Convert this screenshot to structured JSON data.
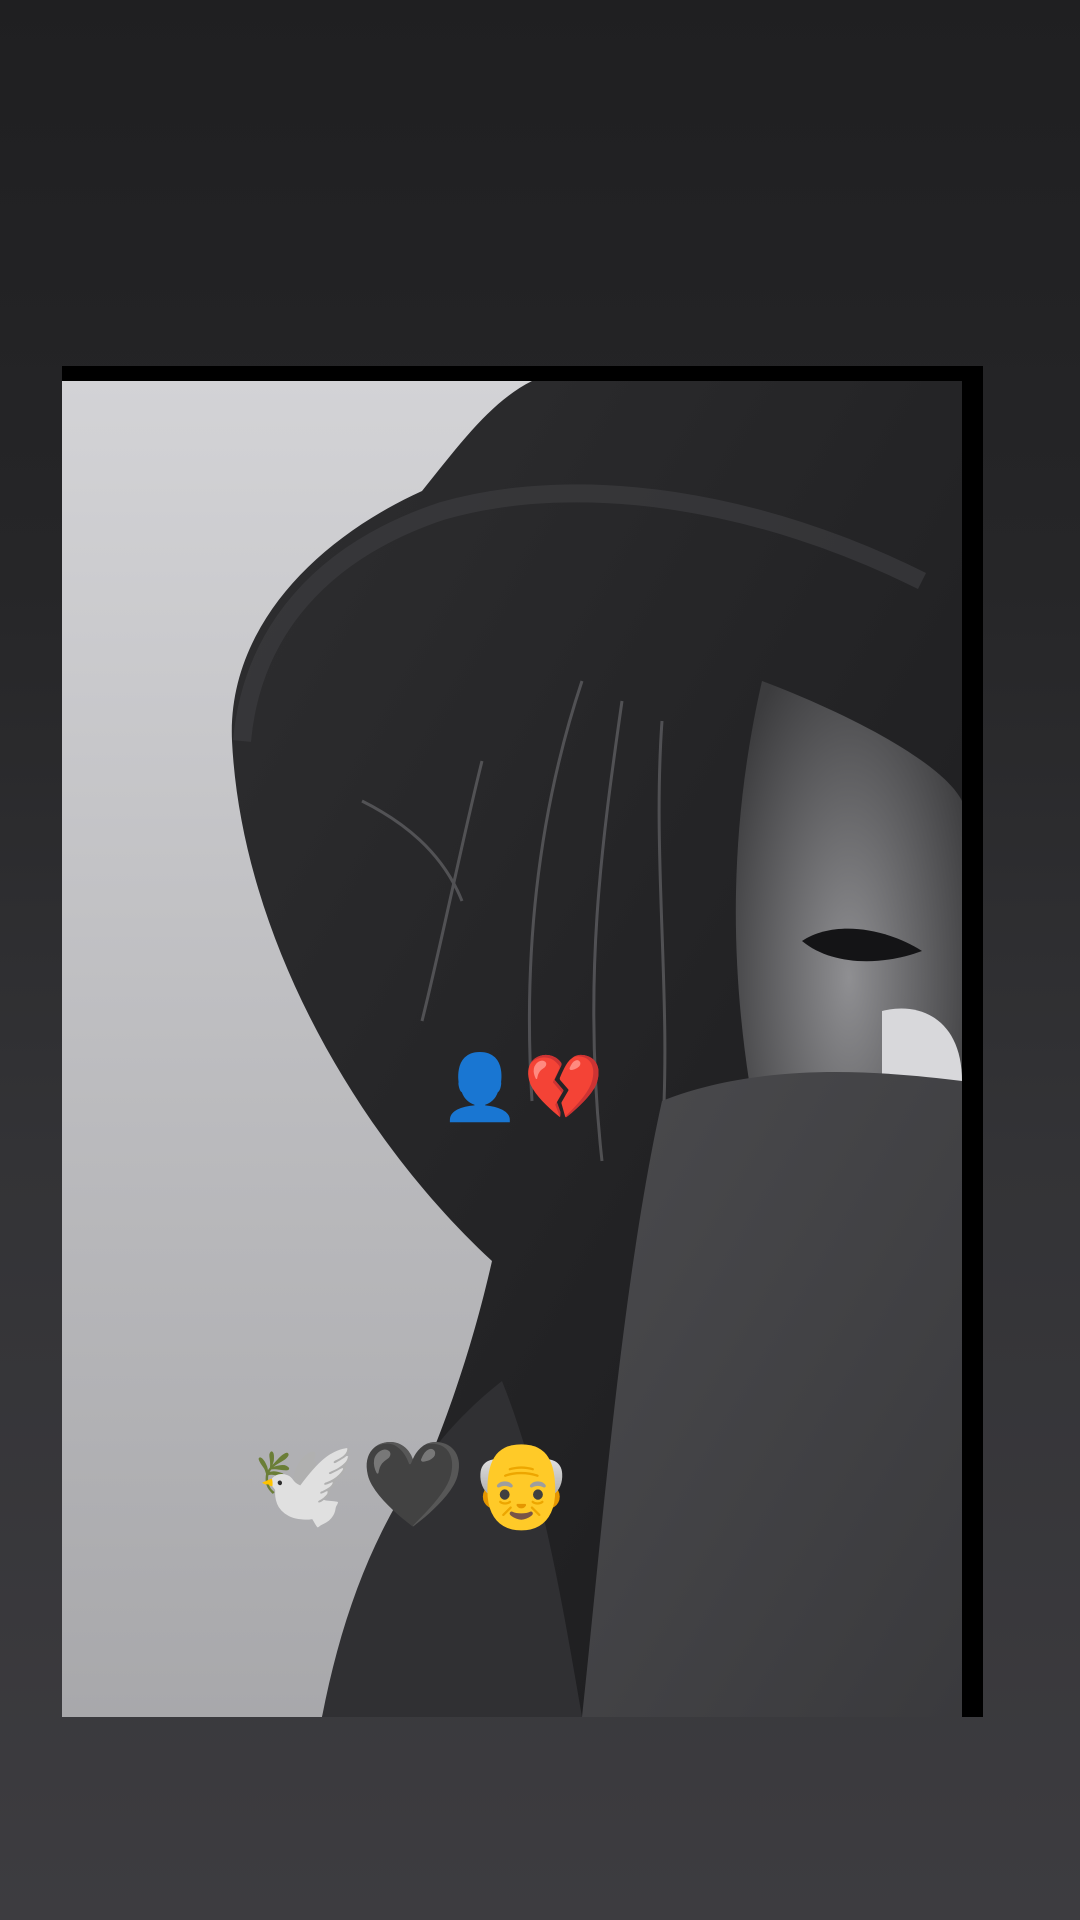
{
  "story": {
    "sticker_top": {
      "emojis": [
        {
          "name": "silhouette",
          "glyph": "👤"
        },
        {
          "name": "broken-heart",
          "glyph": "💔"
        }
      ]
    },
    "sticker_bottom": {
      "emojis": [
        {
          "name": "dove",
          "glyph": "🕊️"
        },
        {
          "name": "black-heart",
          "glyph": "🖤"
        },
        {
          "name": "old-man",
          "glyph": "👴"
        }
      ]
    }
  },
  "colors": {
    "background_top": "#1f1f21",
    "background_bottom": "#3d3c40",
    "frame": "#000000",
    "photo_light": "#d6d6d8",
    "photo_dark": "#1e1e20"
  }
}
